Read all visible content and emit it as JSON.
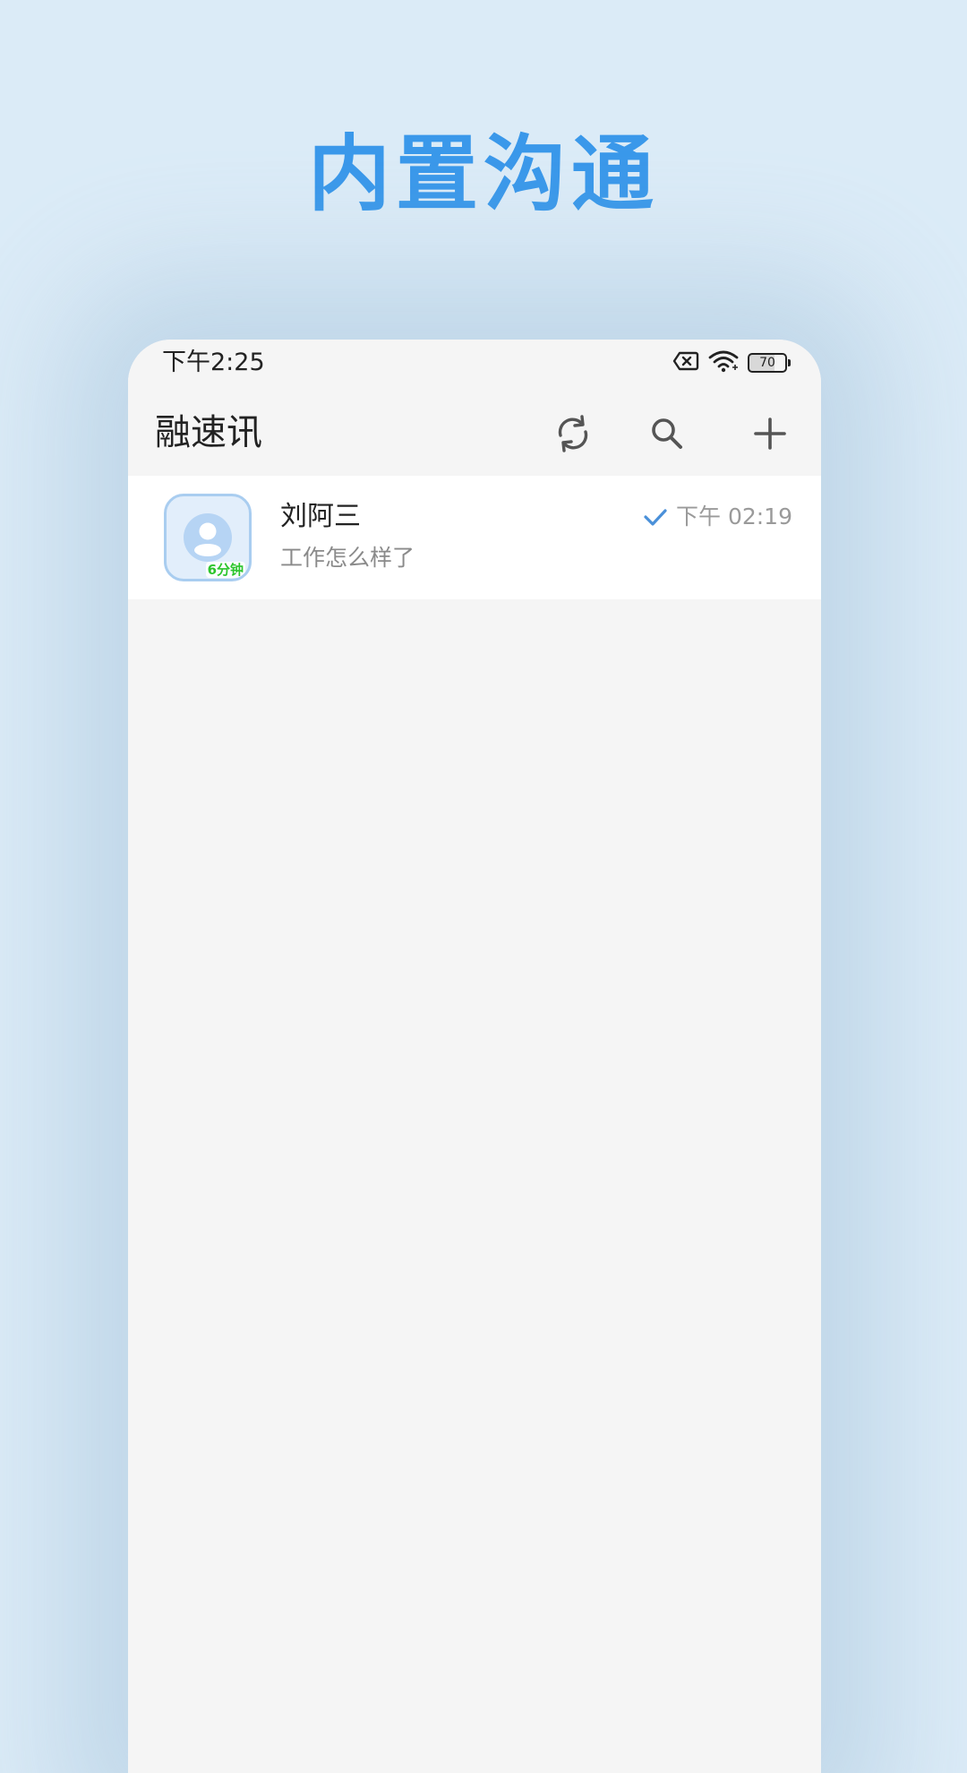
{
  "headline": "内置沟通",
  "status_bar": {
    "time": "下午2:25",
    "battery_level": "70",
    "icons": [
      "sim-off-icon",
      "wifi-icon",
      "battery-icon"
    ]
  },
  "app_bar": {
    "title": "融速讯",
    "actions": [
      "refresh-icon",
      "search-icon",
      "add-icon"
    ]
  },
  "conversations": [
    {
      "name": "刘阿三",
      "preview": "工作怎么样了",
      "time": "下午 02:19",
      "avatar_badge": "6分钟",
      "status_icon": "check-icon"
    }
  ],
  "colors": {
    "headline": "#3a98ea",
    "background": "#dbebf7",
    "accent": "#4a90d9",
    "badge": "#2cc52c"
  }
}
